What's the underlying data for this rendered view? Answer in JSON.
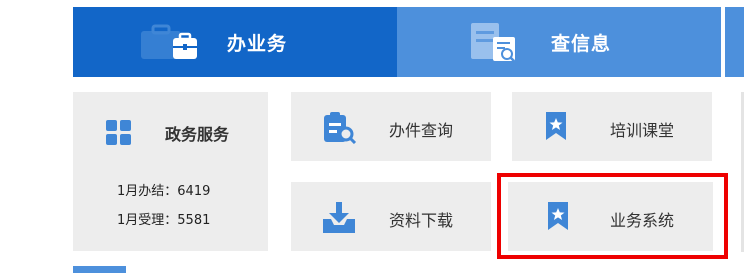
{
  "tabs": [
    {
      "label": "办业务",
      "icon": "briefcase-icon",
      "active": true
    },
    {
      "label": "查信息",
      "icon": "document-search-icon",
      "active": false
    }
  ],
  "gov_services": {
    "title": "政务服务",
    "icon": "grid-icon",
    "stats": [
      "1月办结：6419",
      "1月受理：5581"
    ]
  },
  "tiles": [
    {
      "label": "办件查询",
      "icon": "clipboard-search-icon"
    },
    {
      "label": "培训课堂",
      "icon": "bookmark-star-icon"
    },
    {
      "label": "资料下载",
      "icon": "download-tray-icon"
    },
    {
      "label": "业务系统",
      "icon": "bookmark-star-icon"
    }
  ],
  "colors": {
    "active_tab": "#1266c8",
    "inactive_tab": "#4d90dc",
    "card_bg": "#ededed",
    "icon_blue": "#3f86d6",
    "highlight": "#ee0000"
  }
}
